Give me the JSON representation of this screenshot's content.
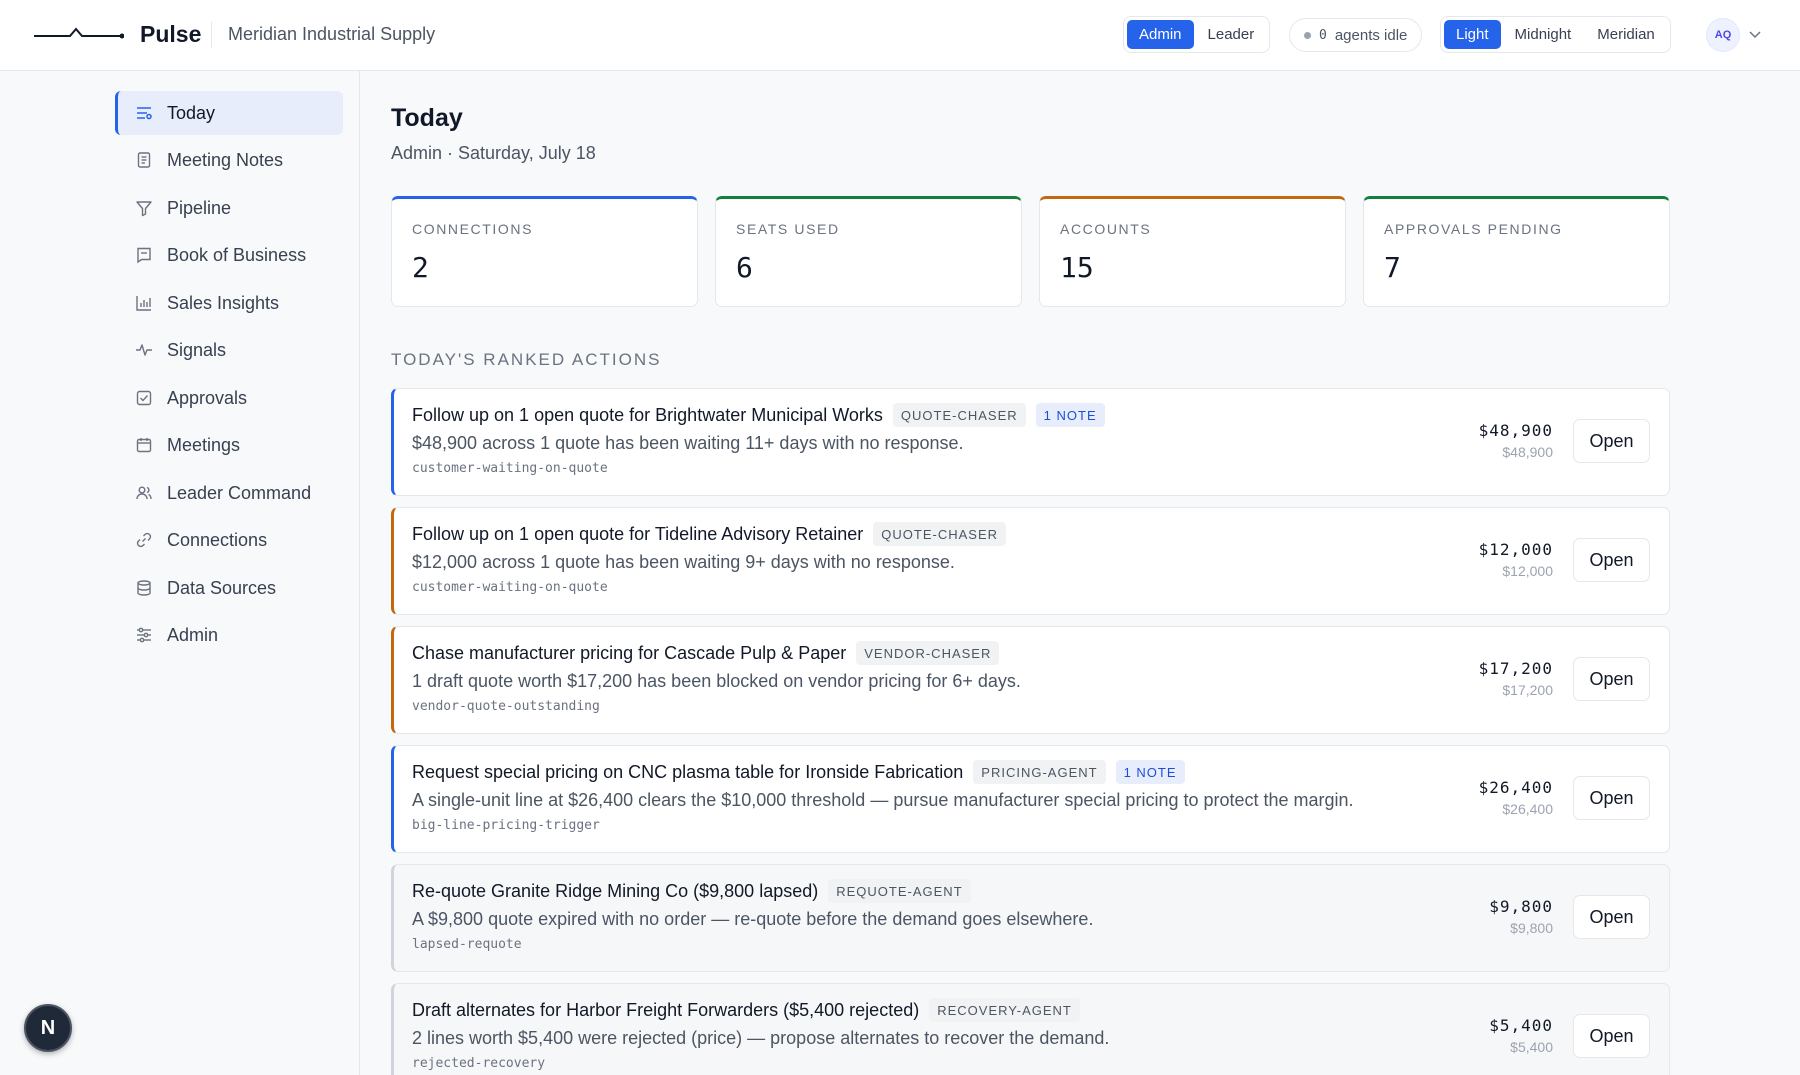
{
  "header": {
    "brand": "Pulse",
    "org": "Meridian Industrial Supply",
    "roles": [
      "Admin",
      "Leader"
    ],
    "agents_count": "0",
    "agents_label": "agents idle",
    "themes": [
      "Light",
      "Midnight",
      "Meridian"
    ],
    "avatar_initials": "AQ"
  },
  "sidebar": {
    "items": [
      {
        "label": "Today",
        "icon": "list-icon"
      },
      {
        "label": "Meeting Notes",
        "icon": "document-icon"
      },
      {
        "label": "Pipeline",
        "icon": "funnel-icon"
      },
      {
        "label": "Book of Business",
        "icon": "book-icon"
      },
      {
        "label": "Sales Insights",
        "icon": "bar-chart-icon"
      },
      {
        "label": "Signals",
        "icon": "pulse-icon"
      },
      {
        "label": "Approvals",
        "icon": "checkbox-icon"
      },
      {
        "label": "Meetings",
        "icon": "calendar-icon"
      },
      {
        "label": "Leader Command",
        "icon": "users-icon"
      },
      {
        "label": "Connections",
        "icon": "link-icon"
      },
      {
        "label": "Data Sources",
        "icon": "database-icon"
      },
      {
        "label": "Admin",
        "icon": "sliders-icon"
      }
    ],
    "fab_label": "N"
  },
  "main": {
    "title": "Today",
    "subtitle": "Admin · Saturday, July 18",
    "stats": [
      {
        "label": "CONNECTIONS",
        "value": "2",
        "color": "#2563eb"
      },
      {
        "label": "SEATS USED",
        "value": "6",
        "color": "#15803d"
      },
      {
        "label": "ACCOUNTS",
        "value": "15",
        "color": "#c2690f"
      },
      {
        "label": "APPROVALS PENDING",
        "value": "7",
        "color": "#15803d"
      }
    ],
    "section_title": "TODAY'S RANKED ACTIONS",
    "actions": [
      {
        "title": "Follow up on 1 open quote for Brightwater Municipal Works",
        "agent": "QUOTE-CHASER",
        "note": "1 NOTE",
        "desc": "$48,900 across 1 quote has been waiting 11+ days with no response.",
        "code": "customer-waiting-on-quote",
        "amount": "$48,900",
        "amount_sub": "$48,900",
        "button": "Open",
        "accent": "#2563eb"
      },
      {
        "title": "Follow up on 1 open quote for Tideline Advisory Retainer",
        "agent": "QUOTE-CHASER",
        "note": "",
        "desc": "$12,000 across 1 quote has been waiting 9+ days with no response.",
        "code": "customer-waiting-on-quote",
        "amount": "$12,000",
        "amount_sub": "$12,000",
        "button": "Open",
        "accent": "#c2690f"
      },
      {
        "title": "Chase manufacturer pricing for Cascade Pulp & Paper",
        "agent": "VENDOR-CHASER",
        "note": "",
        "desc": "1 draft quote worth $17,200 has been blocked on vendor pricing for 6+ days.",
        "code": "vendor-quote-outstanding",
        "amount": "$17,200",
        "amount_sub": "$17,200",
        "button": "Open",
        "accent": "#c2690f"
      },
      {
        "title": "Request special pricing on CNC plasma table for Ironside Fabrication",
        "agent": "PRICING-AGENT",
        "note": "1 NOTE",
        "desc": "A single-unit line at $26,400 clears the $10,000 threshold — pursue manufacturer special pricing to protect the margin.",
        "code": "big-line-pricing-trigger",
        "amount": "$26,400",
        "amount_sub": "$26,400",
        "button": "Open",
        "accent": "#2563eb"
      },
      {
        "title": "Re-quote Granite Ridge Mining Co ($9,800 lapsed)",
        "agent": "REQUOTE-AGENT",
        "note": "",
        "desc": "A $9,800 quote expired with no order — re-quote before the demand goes elsewhere.",
        "code": "lapsed-requote",
        "amount": "$9,800",
        "amount_sub": "$9,800",
        "button": "Open",
        "accent": "#d1d5db"
      },
      {
        "title": "Draft alternates for Harbor Freight Forwarders ($5,400 rejected)",
        "agent": "RECOVERY-AGENT",
        "note": "",
        "desc": "2 lines worth $5,400 were rejected (price) — propose alternates to recover the demand.",
        "code": "rejected-recovery",
        "amount": "$5,400",
        "amount_sub": "$5,400",
        "button": "Open",
        "accent": "#d1d5db"
      }
    ]
  }
}
